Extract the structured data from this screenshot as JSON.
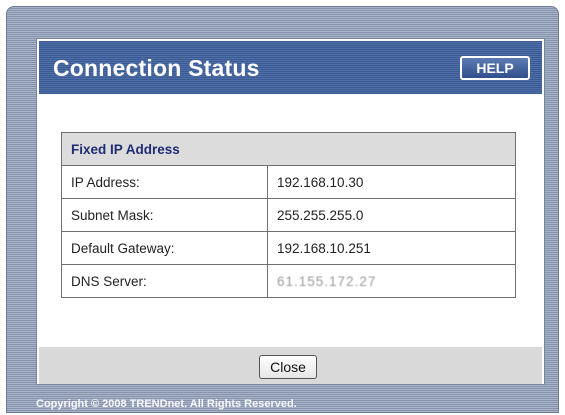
{
  "header": {
    "title": "Connection Status",
    "help_label": "HELP"
  },
  "section": {
    "title": "Fixed IP Address"
  },
  "rows": [
    {
      "label": "IP Address:",
      "value": "192.168.10.30"
    },
    {
      "label": "Subnet Mask:",
      "value": "255.255.255.0"
    },
    {
      "label": "Default Gateway:",
      "value": "192.168.10.251"
    },
    {
      "label": "DNS Server:",
      "value": "61.155.172.27"
    }
  ],
  "footer": {
    "close_label": "Close",
    "copyright": "Copyright © 2008 TRENDnet. All Rights Reserved."
  },
  "colors": {
    "header_blue": "#3a5b96",
    "section_title": "#1f2d74",
    "frame": "#8793ad"
  }
}
